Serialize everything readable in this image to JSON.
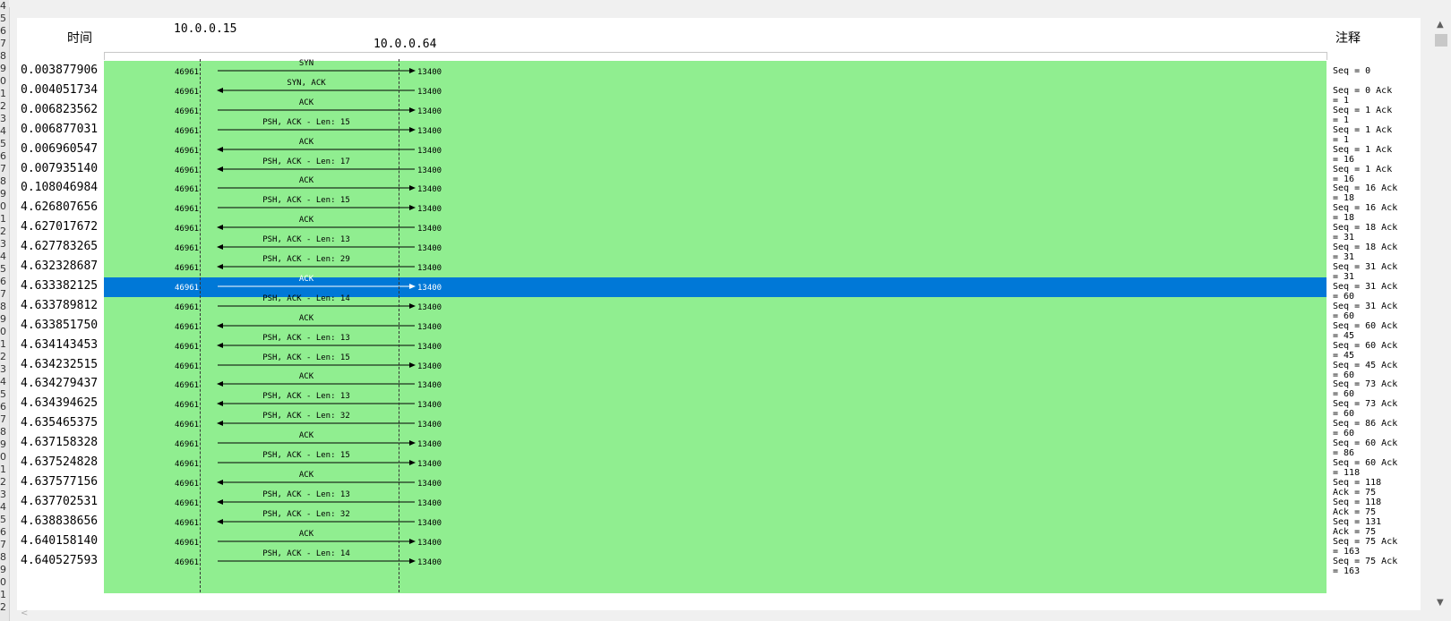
{
  "header": {
    "time_label": "时间",
    "comment_label": "注释",
    "host_left": "10.0.0.15",
    "host_right": "10.0.0.64"
  },
  "gutter_numbers": [
    "4",
    "5",
    "6",
    "7",
    "8",
    "9",
    "0",
    "1",
    "2",
    "3",
    "4",
    "5",
    "6",
    "7",
    "8",
    "9",
    "0",
    "1",
    "2",
    "3",
    "4",
    "5",
    "6",
    "7",
    "8",
    "9",
    "0",
    "1",
    "2",
    "3",
    "4",
    "5",
    "6",
    "7",
    "8",
    "9",
    "0",
    "1",
    "2",
    "3",
    "4",
    "5",
    "6",
    "7",
    "8",
    "9",
    "0",
    "1",
    "2"
  ],
  "rows": [
    {
      "time": "0.003877906",
      "src": "46961",
      "dst": "13400",
      "label": "SYN",
      "dir": "right",
      "note": "Seq = 0"
    },
    {
      "time": "0.004051734",
      "src": "46961",
      "dst": "13400",
      "label": "SYN, ACK",
      "dir": "left",
      "note": "Seq = 0 Ack = 1"
    },
    {
      "time": "0.006823562",
      "src": "46961",
      "dst": "13400",
      "label": "ACK",
      "dir": "right",
      "note": "Seq = 1 Ack = 1"
    },
    {
      "time": "0.006877031",
      "src": "46961",
      "dst": "13400",
      "label": "PSH, ACK - Len: 15",
      "dir": "right",
      "note": "Seq = 1 Ack = 1"
    },
    {
      "time": "0.006960547",
      "src": "46961",
      "dst": "13400",
      "label": "ACK",
      "dir": "left",
      "note": "Seq = 1 Ack = 16"
    },
    {
      "time": "0.007935140",
      "src": "46961",
      "dst": "13400",
      "label": "PSH, ACK - Len: 17",
      "dir": "left",
      "note": "Seq = 1 Ack = 16"
    },
    {
      "time": "0.108046984",
      "src": "46961",
      "dst": "13400",
      "label": "ACK",
      "dir": "right",
      "note": "Seq = 16 Ack = 18"
    },
    {
      "time": "4.626807656",
      "src": "46961",
      "dst": "13400",
      "label": "PSH, ACK - Len: 15",
      "dir": "right",
      "note": "Seq = 16 Ack = 18"
    },
    {
      "time": "4.627017672",
      "src": "46961",
      "dst": "13400",
      "label": "ACK",
      "dir": "left",
      "note": "Seq = 18 Ack = 31"
    },
    {
      "time": "4.627783265",
      "src": "46961",
      "dst": "13400",
      "label": "PSH, ACK - Len: 13",
      "dir": "left",
      "note": "Seq = 18 Ack = 31"
    },
    {
      "time": "4.632328687",
      "src": "46961",
      "dst": "13400",
      "label": "PSH, ACK - Len: 29",
      "dir": "left",
      "note": "Seq = 31 Ack = 31"
    },
    {
      "time": "4.633382125",
      "src": "46961",
      "dst": "13400",
      "label": "ACK",
      "dir": "right",
      "note": "Seq = 31 Ack = 60",
      "selected": true
    },
    {
      "time": "4.633789812",
      "src": "46961",
      "dst": "13400",
      "label": "PSH, ACK - Len: 14",
      "dir": "right",
      "note": "Seq = 31 Ack = 60"
    },
    {
      "time": "4.633851750",
      "src": "46961",
      "dst": "13400",
      "label": "ACK",
      "dir": "left",
      "note": "Seq = 60 Ack = 45"
    },
    {
      "time": "4.634143453",
      "src": "46961",
      "dst": "13400",
      "label": "PSH, ACK - Len: 13",
      "dir": "left",
      "note": "Seq = 60 Ack = 45"
    },
    {
      "time": "4.634232515",
      "src": "46961",
      "dst": "13400",
      "label": "PSH, ACK - Len: 15",
      "dir": "right",
      "note": "Seq = 45 Ack = 60"
    },
    {
      "time": "4.634279437",
      "src": "46961",
      "dst": "13400",
      "label": "ACK",
      "dir": "left",
      "note": "Seq = 73 Ack = 60"
    },
    {
      "time": "4.634394625",
      "src": "46961",
      "dst": "13400",
      "label": "PSH, ACK - Len: 13",
      "dir": "left",
      "note": "Seq = 73 Ack = 60"
    },
    {
      "time": "4.635465375",
      "src": "46961",
      "dst": "13400",
      "label": "PSH, ACK - Len: 32",
      "dir": "left",
      "note": "Seq = 86 Ack = 60"
    },
    {
      "time": "4.637158328",
      "src": "46961",
      "dst": "13400",
      "label": "ACK",
      "dir": "right",
      "note": "Seq = 60 Ack = 86"
    },
    {
      "time": "4.637524828",
      "src": "46961",
      "dst": "13400",
      "label": "PSH, ACK - Len: 15",
      "dir": "right",
      "note": "Seq = 60 Ack = 118"
    },
    {
      "time": "4.637577156",
      "src": "46961",
      "dst": "13400",
      "label": "ACK",
      "dir": "left",
      "note": "Seq = 118 Ack = 75"
    },
    {
      "time": "4.637702531",
      "src": "46961",
      "dst": "13400",
      "label": "PSH, ACK - Len: 13",
      "dir": "left",
      "note": "Seq = 118 Ack = 75"
    },
    {
      "time": "4.638838656",
      "src": "46961",
      "dst": "13400",
      "label": "PSH, ACK - Len: 32",
      "dir": "left",
      "note": "Seq = 131 Ack = 75"
    },
    {
      "time": "4.640158140",
      "src": "46961",
      "dst": "13400",
      "label": "ACK",
      "dir": "right",
      "note": "Seq = 75 Ack = 163"
    },
    {
      "time": "4.640527593",
      "src": "46961",
      "dst": "13400",
      "label": "PSH, ACK - Len: 14",
      "dir": "right",
      "note": "Seq = 75 Ack = 163"
    }
  ],
  "colors": {
    "graph_background": "#90ee90",
    "selected_row": "#0078d7"
  },
  "icons": {
    "scroll_up": "chevron-up-icon",
    "scroll_down": "chevron-down-icon",
    "scroll_left": "chevron-left-icon"
  }
}
